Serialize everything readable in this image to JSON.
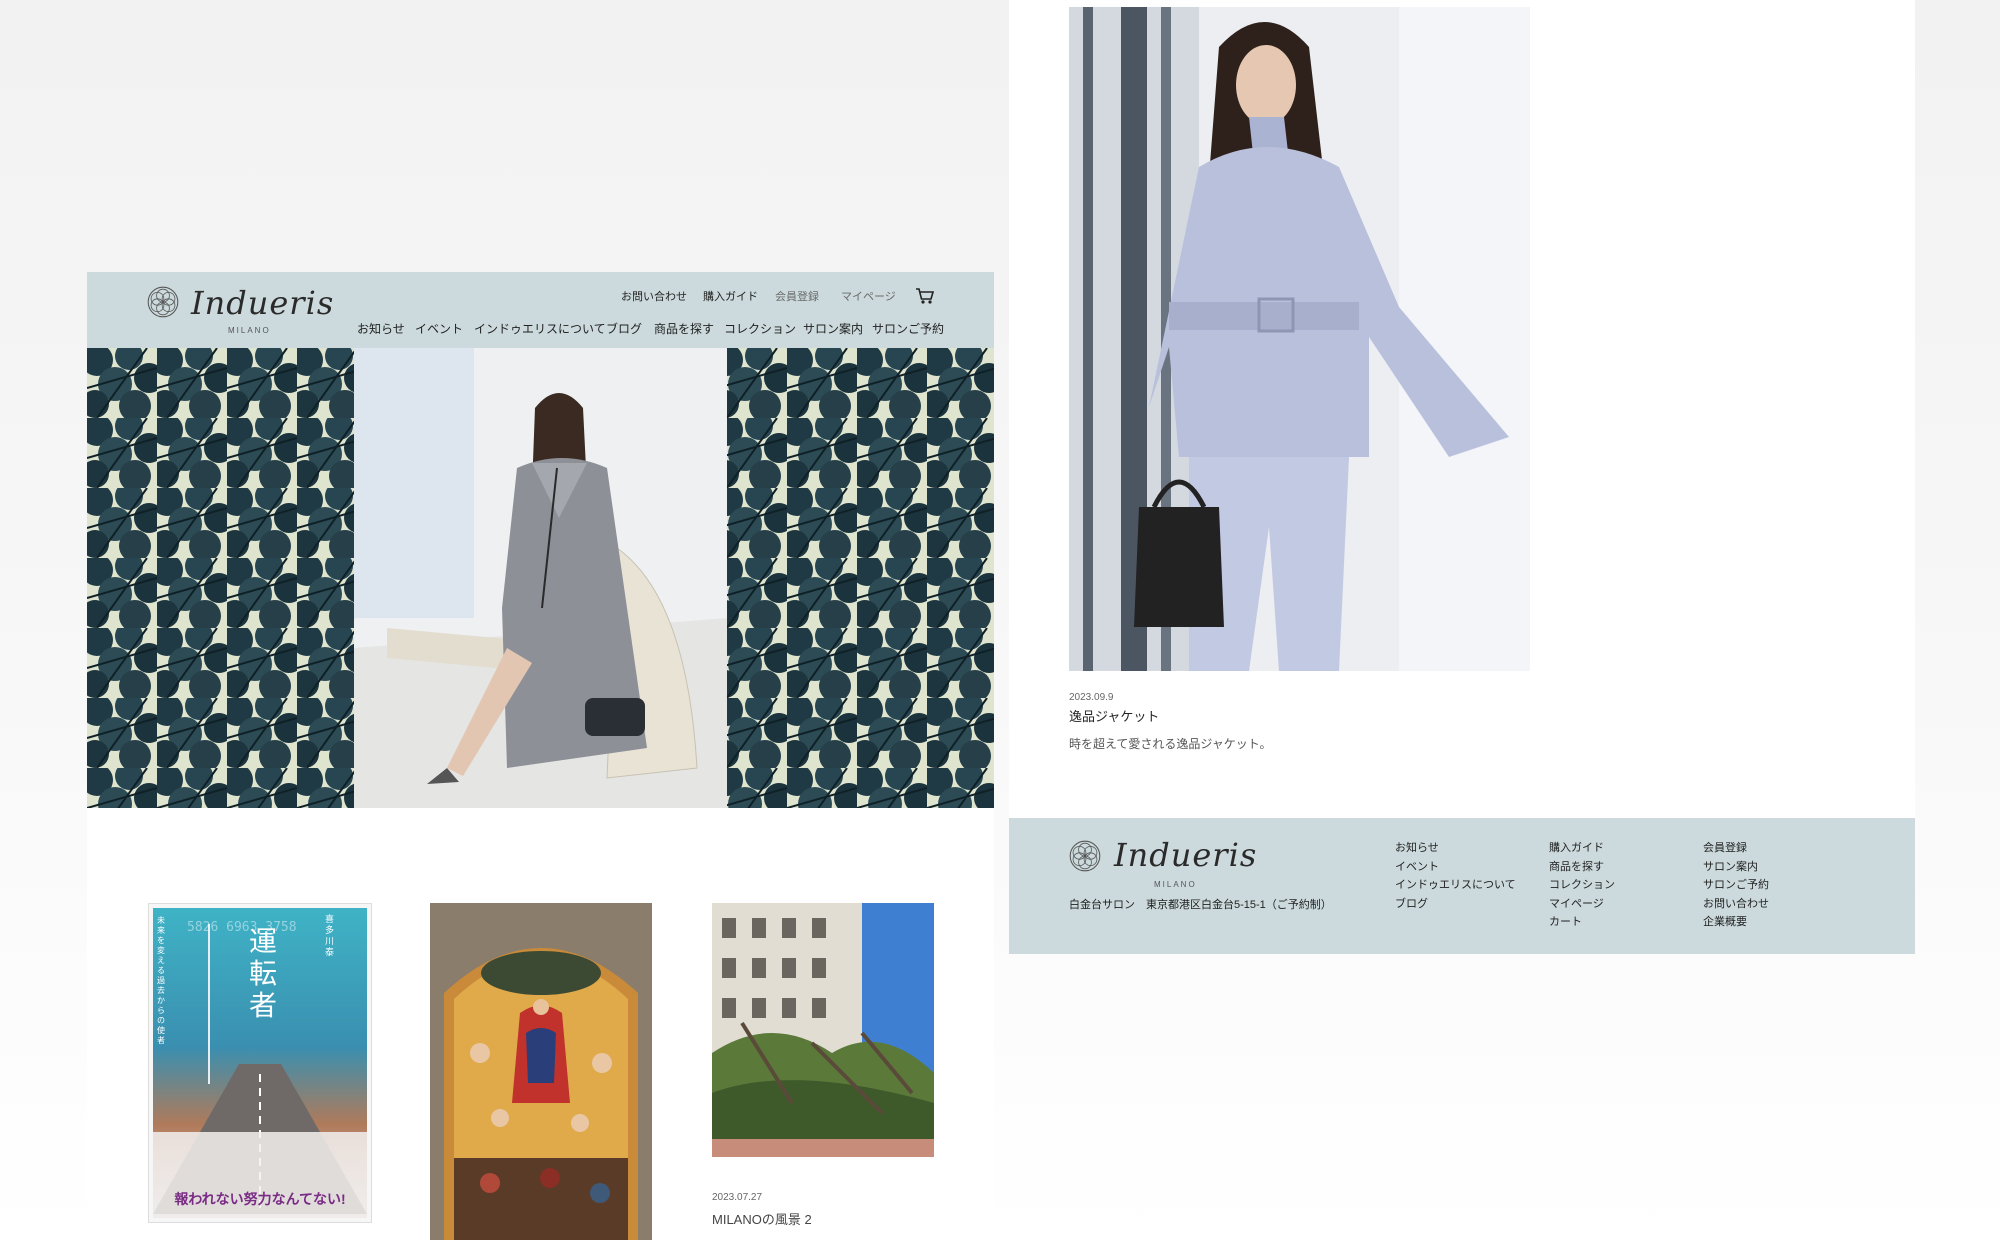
{
  "brand": {
    "name": "Indueris",
    "subtitle": "MILANO"
  },
  "header": {
    "utility_links": [
      "お問い合わせ",
      "購入ガイド",
      "会員登録",
      "マイページ"
    ],
    "cart_icon": "cart-icon",
    "nav": [
      "お知らせ",
      "イベント",
      "インドゥエリスについて",
      "ブログ",
      "商品を探す",
      "コレクション",
      "サロン案内",
      "サロンご予約"
    ]
  },
  "hero": {
    "image": "model-seated-in-lounge-chair-framed-by-tree-silhouettes"
  },
  "blog_cards": [
    {
      "image": "book-cover",
      "cover_title": "運転者",
      "cover_author": "喜多川泰",
      "cover_tagline": "未来を変える過去からの使者",
      "cover_blurb": "報われない努力なんてない!",
      "cover_numbers": "5826 6963 3758",
      "date": "",
      "title": ""
    },
    {
      "image": "renaissance-painting-assumption",
      "date": "",
      "title": ""
    },
    {
      "image": "milano-street-fallen-trees",
      "date": "2023.07.27",
      "title": "MILANOの風景 2"
    }
  ],
  "feature": {
    "image": "model-in-lavender-jacket-and-scarf",
    "date": "2023.09.9",
    "title": "逸品ジャケット",
    "description": "時を超えて愛される逸品ジャケット。"
  },
  "footer": {
    "address": "白金台サロン　東京都港区白金台5-15-1（ご予約制）",
    "columns": [
      [
        "お知らせ",
        "イベント",
        "インドゥエリスについて",
        "ブログ"
      ],
      [
        "購入ガイド",
        "商品を探す",
        "コレクション",
        "マイページ",
        "カート"
      ],
      [
        "会員登録",
        "サロン案内",
        "サロンご予約",
        "お問い合わせ",
        "企業概要"
      ]
    ]
  },
  "colors": {
    "header_bg": "#ccdadd",
    "footer_bg": "#ccdadd",
    "text": "#222222"
  }
}
